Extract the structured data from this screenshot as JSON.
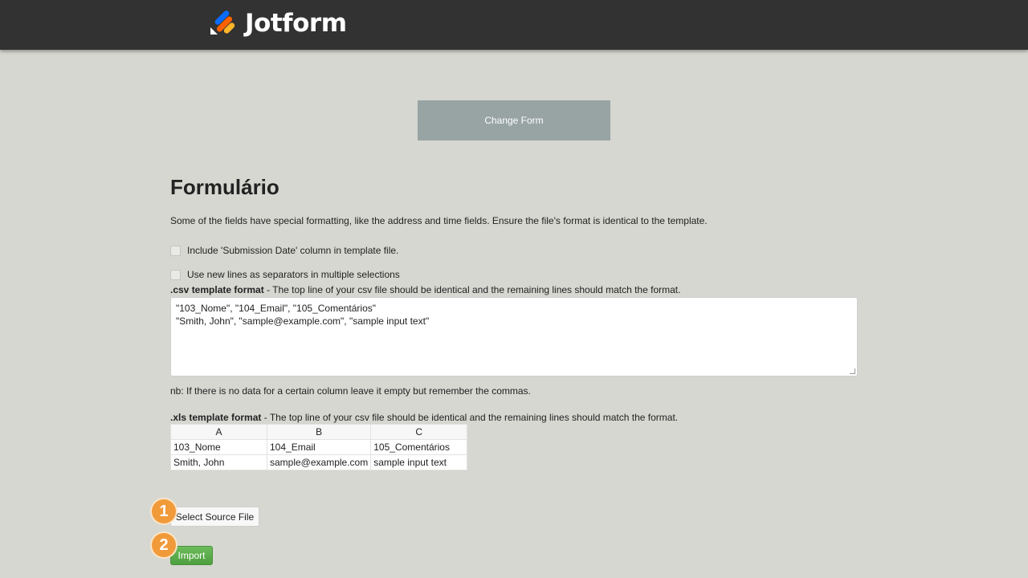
{
  "header": {
    "logo_text": "Jotform",
    "logo_colors": [
      "#0a6cff",
      "#ff6100",
      "#ffb629",
      "#ffffff"
    ]
  },
  "change_form_label": "Change Form",
  "page_title": "Formulário",
  "description": "Some of the fields have special formatting, like the address and time fields. Ensure the file's format is identical to the template.",
  "options": {
    "include_submission_date": "Include 'Submission Date' column in template file.",
    "new_lines_separators": "Use new lines as separators in multiple selections"
  },
  "csv": {
    "label_bold": ".csv template format",
    "label_rest": " - The top line of your csv file should be identical and the remaining lines should match the format.",
    "line1": "\"103_Nome\", \"104_Email\", \"105_Comentários\"",
    "line2": "\"Smith, John\", \"sample@example.com\", \"sample input text\""
  },
  "nb_text": "nb: If there is no data for a certain column leave it empty but remember the commas.",
  "xls": {
    "label_bold": ".xls template format",
    "label_rest": " - The top line of your csv file should be identical and the remaining lines should match the format.",
    "columns": [
      "A",
      "B",
      "C"
    ],
    "rows": [
      [
        "103_Nome",
        "104_Email",
        "105_Comentários"
      ],
      [
        "Smith, John",
        "sample@example.com",
        "sample input text"
      ]
    ]
  },
  "steps": [
    "1",
    "2"
  ],
  "select_source_label": "Select Source File",
  "import_label": "Import"
}
